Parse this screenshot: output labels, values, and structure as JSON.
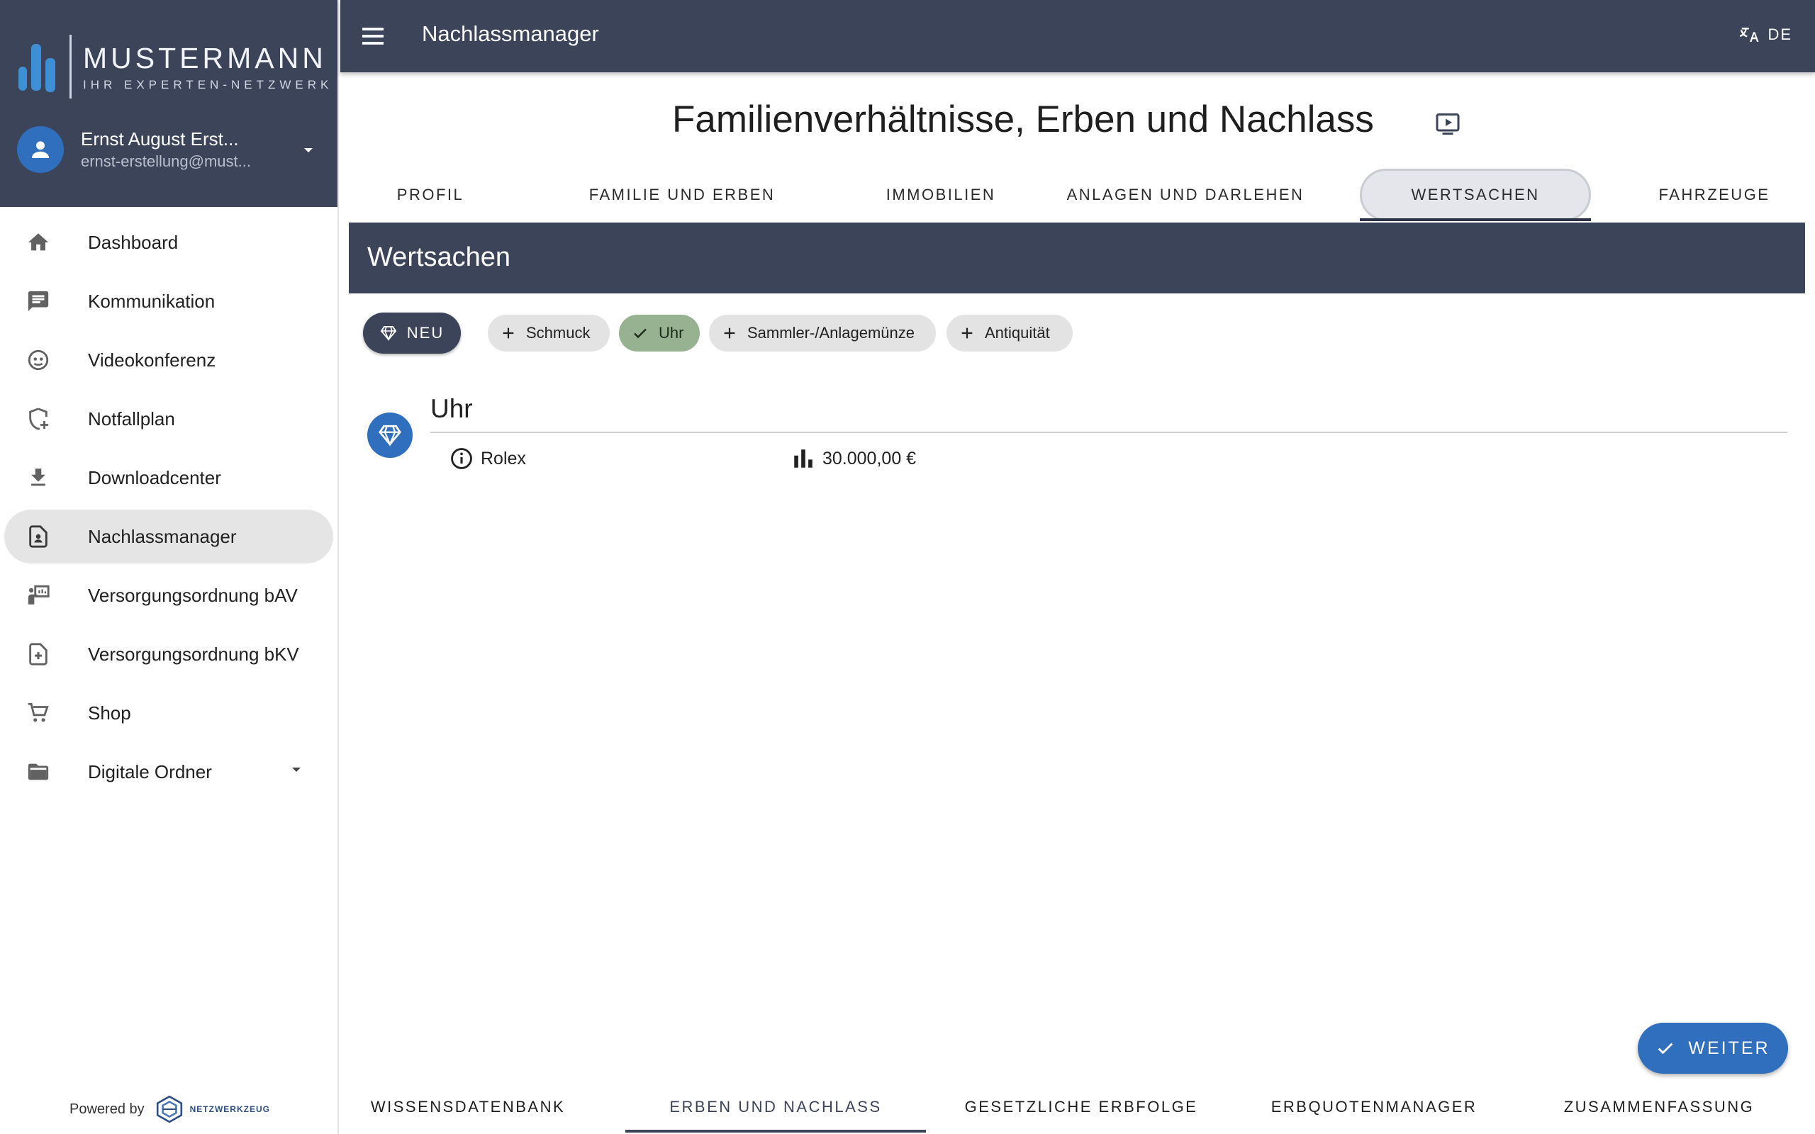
{
  "brand": {
    "name": "MUSTERMANN",
    "tagline": "IHR EXPERTEN-NETZWERK"
  },
  "user": {
    "name": "Ernst August Erst...",
    "email": "ernst-erstellung@must..."
  },
  "nav": [
    {
      "label": "Dashboard",
      "icon": "home-icon"
    },
    {
      "label": "Kommunikation",
      "icon": "chat-icon"
    },
    {
      "label": "Videokonferenz",
      "icon": "video-conference-icon"
    },
    {
      "label": "Notfallplan",
      "icon": "shield-plus-icon"
    },
    {
      "label": "Downloadcenter",
      "icon": "download-icon"
    },
    {
      "label": "Nachlassmanager",
      "icon": "document-person-icon",
      "active": true
    },
    {
      "label": "Versorgungsordnung bAV",
      "icon": "presentation-icon"
    },
    {
      "label": "Versorgungsordnung bKV",
      "icon": "document-medical-icon"
    },
    {
      "label": "Shop",
      "icon": "cart-icon"
    },
    {
      "label": "Digitale Ordner",
      "icon": "folder-open-icon"
    }
  ],
  "powered": {
    "label": "Powered by",
    "brand": "NETZWERKZEUG"
  },
  "topbar": {
    "title": "Nachlassmanager",
    "language": "DE"
  },
  "page": {
    "title": "Familienverhältnisse, Erben und Nachlass"
  },
  "tabs": [
    {
      "label": "PROFIL"
    },
    {
      "label": "FAMILIE UND ERBEN"
    },
    {
      "label": "IMMOBILIEN"
    },
    {
      "label": "ANLAGEN UND DARLEHEN"
    },
    {
      "label": "WERTSACHEN",
      "active": true
    },
    {
      "label": "FAHRZEUGE"
    }
  ],
  "section": {
    "title": "Wertsachen"
  },
  "chips": {
    "new_label": "NEU",
    "options": [
      {
        "label": "Schmuck",
        "selected": false
      },
      {
        "label": "Uhr",
        "selected": true
      },
      {
        "label": "Sammler-/Anlagemünze",
        "selected": false
      },
      {
        "label": "Antiquität",
        "selected": false
      }
    ]
  },
  "item": {
    "title": "Uhr",
    "name": "Rolex",
    "value": "30.000,00 €"
  },
  "fab": {
    "label": "WEITER"
  },
  "bottom_tabs": [
    {
      "label": "WISSENSDATENBANK"
    },
    {
      "label": "ERBEN UND NACHLASS",
      "active": true
    },
    {
      "label": "GESETZLICHE ERBFOLGE"
    },
    {
      "label": "ERBQUOTENMANAGER"
    },
    {
      "label": "ZUSAMMENFASSUNG"
    }
  ],
  "colors": {
    "primary_dark": "#3b4459",
    "accent_blue": "#2f6fbd",
    "chip_selected": "#97b290",
    "chip_default": "#e3e3e3"
  }
}
